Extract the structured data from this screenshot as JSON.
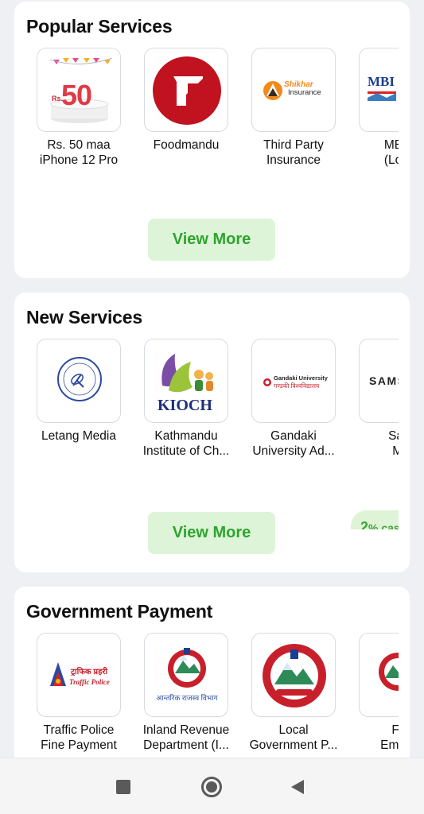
{
  "popular": {
    "title": "Popular Services",
    "items": [
      {
        "line1": "Rs. 50 maa",
        "line2": "iPhone 12 Pro",
        "icon": "iphone-offer-icon",
        "logo_text": "50",
        "logo_sub": "Rs."
      },
      {
        "line1": "Foodmandu",
        "line2": "",
        "icon": "foodmandu-logo-icon"
      },
      {
        "line1": "Third Party",
        "line2": "Insurance",
        "icon": "shikhar-insurance-logo-icon",
        "logo_text": "Shikhar",
        "logo_sub": "Insurance"
      },
      {
        "line1": "MBJC",
        "line2": "(Local",
        "icon": "mbjc-logo-icon",
        "logo_text": "MBI"
      }
    ],
    "view_more": "View More"
  },
  "new_services": {
    "title": "New Services",
    "items": [
      {
        "line1": "Letang Media",
        "line2": "",
        "icon": "letang-media-logo-icon"
      },
      {
        "line1": "Kathmandu",
        "line2": "Institute of Ch...",
        "icon": "kioch-logo-icon",
        "logo_text": "KIOCH"
      },
      {
        "line1": "Gandaki",
        "line2": "University Ad...",
        "icon": "gandaki-university-logo-icon",
        "logo_text": "Gandaki University",
        "logo_sub": "गण्डकी विश्वविद्यालय"
      },
      {
        "line1": "Sam",
        "line2": "Mo",
        "icon": "samsung-logo-icon",
        "logo_text": "SAMS"
      }
    ],
    "cashback_value": "2",
    "cashback_rest": "% cas",
    "view_more": "View More"
  },
  "government": {
    "title": "Government Payment",
    "items": [
      {
        "line1": "Traffic Police",
        "line2": "Fine Payment",
        "icon": "traffic-police-logo-icon",
        "logo_text": "ट्राफिक प्रहरी",
        "logo_sub": "Traffic Police"
      },
      {
        "line1": "Inland Revenue",
        "line2": "Department (I...",
        "icon": "nepal-emblem-icon",
        "logo_text": "आन्तरिक राजस्व विभाग"
      },
      {
        "line1": "Local",
        "line2": "Government P...",
        "icon": "nepal-emblem-icon"
      },
      {
        "line1": "For",
        "line2": "Employ",
        "icon": "nepal-emblem-icon"
      }
    ]
  },
  "colors": {
    "accent_green": "#2ea52e",
    "button_bg": "#ddf4d8",
    "background": "#eef0f3"
  },
  "navbar": {
    "icons": [
      "recent-apps-icon",
      "home-icon",
      "back-icon"
    ]
  }
}
